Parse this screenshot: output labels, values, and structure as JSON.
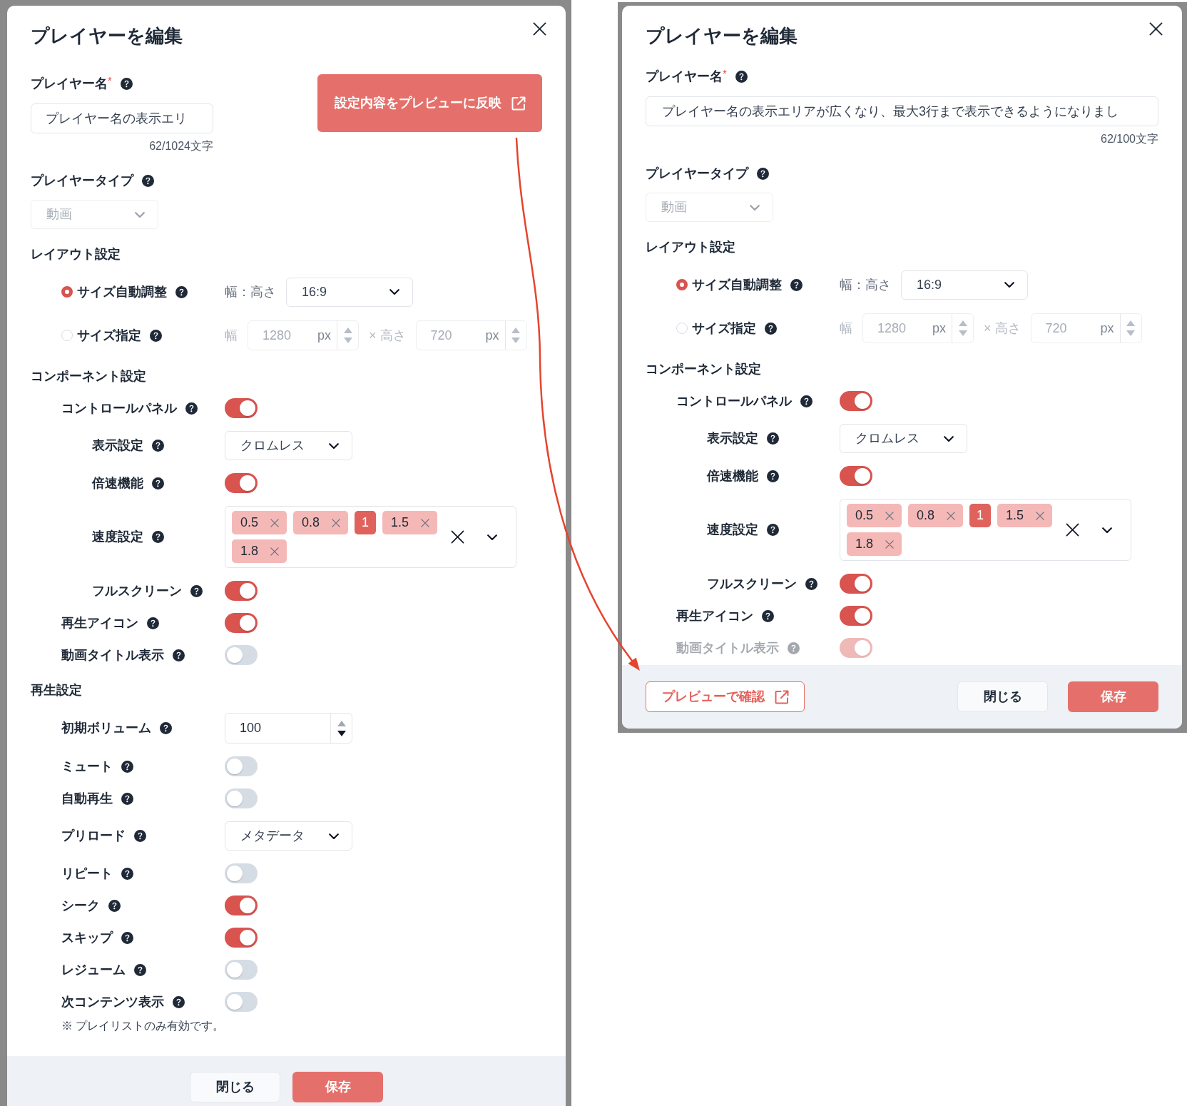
{
  "screenshots": [
    {
      "title": "プレイヤーを編集",
      "name_field": {
        "label": "プレイヤー名",
        "required_mark": "*",
        "help": true,
        "value": "プレイヤー名の表示エリ",
        "counter": "62/1024文字"
      },
      "preview_button": {
        "kind": "callout",
        "label": "設定内容をプレビューに反映"
      },
      "type_field": {
        "label": "プレイヤータイプ",
        "help": true,
        "value": "動画",
        "disabled": true
      },
      "sections": [
        {
          "heading": "レイアウト設定",
          "rows": [
            {
              "kind": "radio",
              "label": "サイズ自動調整",
              "help": true,
              "selected": true,
              "fields": [
                {
                  "kind": "text",
                  "text": "幅：高さ"
                },
                {
                  "kind": "select",
                  "value": "16:9"
                }
              ]
            },
            {
              "kind": "radio",
              "label": "サイズ指定",
              "help": true,
              "selected": false,
              "fields": [
                {
                  "kind": "text",
                  "text": "幅"
                },
                {
                  "kind": "number",
                  "value": "1280",
                  "unit": "px"
                },
                {
                  "kind": "text",
                  "text": "× 高さ"
                },
                {
                  "kind": "number",
                  "value": "720",
                  "unit": "px"
                }
              ]
            }
          ]
        },
        {
          "heading": "コンポーネント設定",
          "rows": [
            {
              "kind": "toggle",
              "label": "コントロールパネル",
              "help": true,
              "on": true,
              "children": [
                {
                  "kind": "select",
                  "label": "表示設定",
                  "help": true,
                  "value": "クロムレス"
                },
                {
                  "kind": "toggle",
                  "label": "倍速機能",
                  "help": true,
                  "on": true
                },
                {
                  "kind": "multiselect",
                  "label": "速度設定",
                  "help": true,
                  "chips": [
                    {
                      "text": "0.5",
                      "removable": true
                    },
                    {
                      "text": "0.8",
                      "removable": true
                    },
                    {
                      "text": "1",
                      "removable": false
                    },
                    {
                      "text": "1.5",
                      "removable": true
                    },
                    {
                      "text": "1.8",
                      "removable": true
                    }
                  ]
                },
                {
                  "kind": "toggle",
                  "label": "フルスクリーン",
                  "help": true,
                  "on": true
                }
              ]
            },
            {
              "kind": "toggle",
              "label": "再生アイコン",
              "help": true,
              "on": true
            },
            {
              "kind": "toggle",
              "label": "動画タイトル表示",
              "help": true,
              "on": false
            }
          ]
        },
        {
          "heading": "再生設定",
          "rows": [
            {
              "kind": "number",
              "label": "初期ボリューム",
              "help": true,
              "value": "100"
            },
            {
              "kind": "toggle",
              "label": "ミュート",
              "help": true,
              "on": false
            },
            {
              "kind": "toggle",
              "label": "自動再生",
              "help": true,
              "on": false
            },
            {
              "kind": "select",
              "label": "プリロード",
              "help": true,
              "value": "メタデータ"
            },
            {
              "kind": "toggle",
              "label": "リピート",
              "help": true,
              "on": false
            },
            {
              "kind": "toggle",
              "label": "シーク",
              "help": true,
              "on": true
            },
            {
              "kind": "toggle",
              "label": "スキップ",
              "help": true,
              "on": true
            },
            {
              "kind": "toggle",
              "label": "レジューム",
              "help": true,
              "on": false
            },
            {
              "kind": "toggle",
              "label": "次コンテンツ表示",
              "help": true,
              "on": false,
              "note": "※ プレイリストのみ有効です。"
            }
          ]
        }
      ],
      "footer_buttons": [
        {
          "kind": "secondary",
          "label": "閉じる"
        },
        {
          "kind": "primary",
          "label": "保存"
        }
      ]
    },
    {
      "title": "プレイヤーを編集",
      "name_field": {
        "label": "プレイヤー名",
        "required_mark": "*",
        "help": true,
        "value": "プレイヤー名の表示エリアが広くなり、最大3行まで表示できるようになりまし",
        "counter": "62/100文字"
      },
      "preview_button": {
        "kind": "outline",
        "label": "プレビューで確認"
      },
      "type_field": {
        "label": "プレイヤータイプ",
        "help": true,
        "value": "動画",
        "disabled": true
      },
      "sections": [
        {
          "heading": "レイアウト設定",
          "rows": [
            {
              "kind": "radio",
              "label": "サイズ自動調整",
              "help": true,
              "selected": true,
              "fields": [
                {
                  "kind": "text",
                  "text": "幅：高さ"
                },
                {
                  "kind": "select",
                  "value": "16:9"
                }
              ]
            },
            {
              "kind": "radio",
              "label": "サイズ指定",
              "help": true,
              "selected": false,
              "fields": [
                {
                  "kind": "text",
                  "text": "幅"
                },
                {
                  "kind": "number",
                  "value": "1280",
                  "unit": "px"
                },
                {
                  "kind": "text",
                  "text": "× 高さ"
                },
                {
                  "kind": "number",
                  "value": "720",
                  "unit": "px"
                }
              ]
            }
          ]
        },
        {
          "heading": "コンポーネント設定",
          "rows": [
            {
              "kind": "toggle",
              "label": "コントロールパネル",
              "help": true,
              "on": true,
              "faded": false,
              "children": [
                {
                  "kind": "select",
                  "label": "表示設定",
                  "help": true,
                  "value": "クロムレス"
                },
                {
                  "kind": "toggle",
                  "label": "倍速機能",
                  "help": true,
                  "on": true
                },
                {
                  "kind": "multiselect",
                  "label": "速度設定",
                  "help": true,
                  "chips": [
                    {
                      "text": "0.5",
                      "removable": true
                    },
                    {
                      "text": "0.8",
                      "removable": true
                    },
                    {
                      "text": "1",
                      "removable": false
                    },
                    {
                      "text": "1.5",
                      "removable": true
                    },
                    {
                      "text": "1.8",
                      "removable": true
                    }
                  ]
                },
                {
                  "kind": "toggle",
                  "label": "フルスクリーン",
                  "help": true,
                  "on": true
                }
              ]
            },
            {
              "kind": "toggle",
              "label": "再生アイコン",
              "help": true,
              "on": true,
              "faded": false
            },
            {
              "kind": "toggle",
              "label": "動画タイトル表示",
              "help": true,
              "on": true,
              "faded": true
            }
          ]
        }
      ],
      "footer_buttons": [
        {
          "kind": "secondary",
          "label": "閉じる"
        },
        {
          "kind": "primary",
          "label": "保存"
        }
      ]
    }
  ]
}
